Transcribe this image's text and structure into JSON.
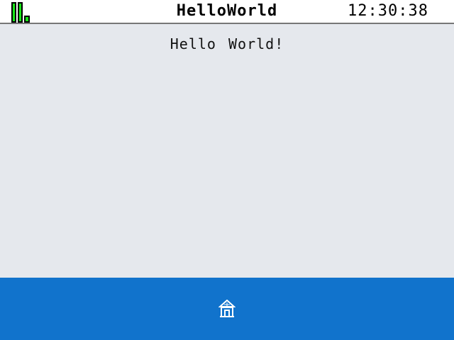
{
  "status_bar": {
    "title": "HelloWorld",
    "time": "12:30:38",
    "signal_icon": "signal-bars-icon",
    "signal_color": "#19e619"
  },
  "main": {
    "message": "Hello World!"
  },
  "bottom_bar": {
    "background": "#1173cc",
    "home_icon": "home-icon"
  }
}
